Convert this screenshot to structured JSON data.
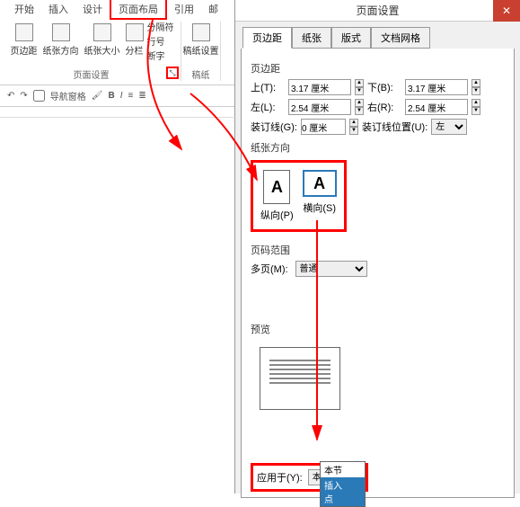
{
  "ribbon": {
    "tabs": [
      "开始",
      "插入",
      "设计",
      "页面布局",
      "引用",
      "邮"
    ],
    "active_tab": "页面布局",
    "groups": {
      "page_setup": {
        "title": "页面设置",
        "margins": "页边距",
        "orientation": "纸张方向",
        "size": "纸张大小",
        "columns": "分栏",
        "breaks": "分隔符",
        "line_numbers": "行号",
        "hyphenation": "断字"
      },
      "draft": {
        "title": "稿纸",
        "draft_setup": "稿纸设置"
      }
    }
  },
  "qat": {
    "nav_pane": "导航窗格",
    "bold": "B",
    "italic": "I"
  },
  "dialog": {
    "title": "页面设置",
    "tabs": [
      "页边距",
      "纸张",
      "版式",
      "文档网格"
    ],
    "active": "页边距",
    "margins": {
      "section": "页边距",
      "top_lbl": "上(T):",
      "top": "3.17 厘米",
      "bottom_lbl": "下(B):",
      "bottom": "3.17 厘米",
      "left_lbl": "左(L):",
      "left": "2.54 厘米",
      "right_lbl": "右(R):",
      "right": "2.54 厘米",
      "gutter_lbl": "装订线(G):",
      "gutter": "0 厘米",
      "gutter_pos_lbl": "装订线位置(U):",
      "gutter_pos": "左"
    },
    "orientation": {
      "section": "纸张方向",
      "portrait": "纵向(P)",
      "landscape": "横向(S)"
    },
    "page_range": {
      "section": "页码范围",
      "multi_lbl": "多页(M):",
      "multi": "普通"
    },
    "preview": {
      "section": "预览"
    },
    "apply": {
      "label": "应用于(Y):",
      "value": "本节",
      "options": [
        "本节",
        "插入点"
      ]
    }
  }
}
